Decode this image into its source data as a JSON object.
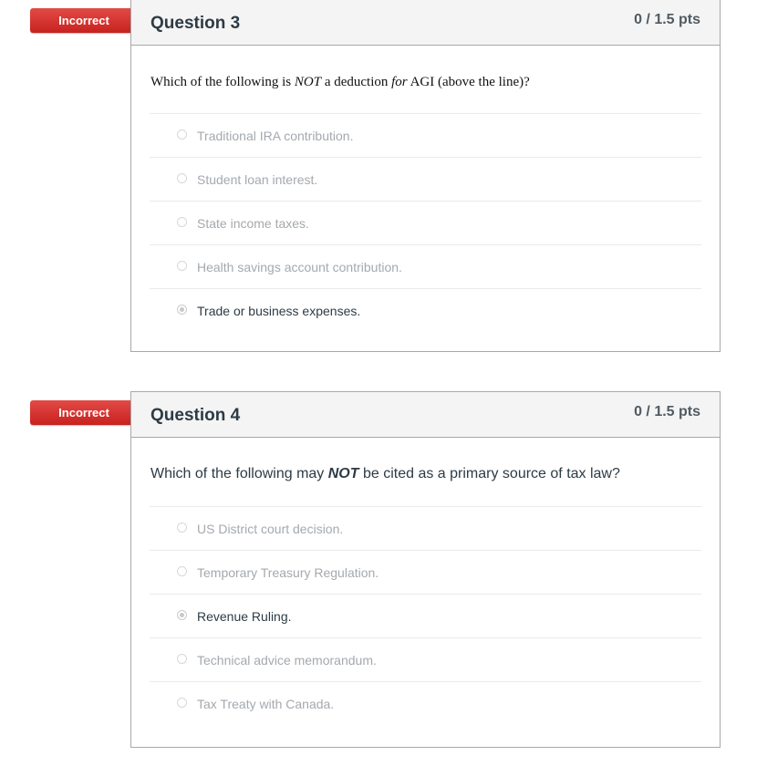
{
  "questions": [
    {
      "status": "Incorrect",
      "title": "Question 3",
      "points": "0 / 1.5 pts",
      "text_parts": {
        "before": "Which of the following is ",
        "emph1": "NOT",
        "middle": " a deduction ",
        "emph2": "for",
        "after": " AGI (above the line)?"
      },
      "answers": [
        {
          "label": "Traditional IRA contribution.",
          "selected": false
        },
        {
          "label": "Student loan interest.",
          "selected": false
        },
        {
          "label": "State income taxes.",
          "selected": false
        },
        {
          "label": "Health savings account contribution.",
          "selected": false
        },
        {
          "label": "Trade or business expenses.",
          "selected": true
        }
      ]
    },
    {
      "status": "Incorrect",
      "title": "Question 4",
      "points": "0 / 1.5 pts",
      "text_parts": {
        "before": "Which of the following may ",
        "emph1": "NOT",
        "after": " be cited as a primary source of tax law?"
      },
      "answers": [
        {
          "label": "US District court decision.",
          "selected": false
        },
        {
          "label": "Temporary Treasury Regulation.",
          "selected": false
        },
        {
          "label": "Revenue Ruling.",
          "selected": true
        },
        {
          "label": "Technical advice memorandum.",
          "selected": false
        },
        {
          "label": "Tax Treaty with Canada.",
          "selected": false
        }
      ]
    }
  ],
  "colors": {
    "incorrect_badge": "#d2312d",
    "title_text": "#2d3b45",
    "unselected_answer": "#a4a9ae"
  }
}
